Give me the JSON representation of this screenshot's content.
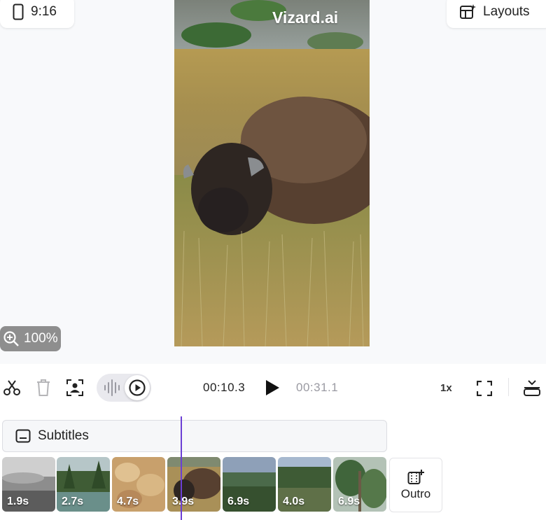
{
  "canvas": {
    "aspect_ratio": "9:16",
    "layouts_label": "Layouts",
    "zoom_level": "100%",
    "watermark": "Vizard.ai"
  },
  "playback": {
    "current_time": "00:10.3",
    "total_time": "00:31.1",
    "speed": "1x"
  },
  "tracks": {
    "subtitles_label": "Subtitles",
    "clips": [
      {
        "duration": "1.9s"
      },
      {
        "duration": "2.7s"
      },
      {
        "duration": "4.7s"
      },
      {
        "duration": "3.9s"
      },
      {
        "duration": "6.9s"
      },
      {
        "duration": "4.0s"
      },
      {
        "duration": "6.9s"
      }
    ],
    "outro_label": "Outro"
  },
  "colors": {
    "playhead": "#6b3fd4",
    "canvas_bg": "#f8f9fb"
  }
}
